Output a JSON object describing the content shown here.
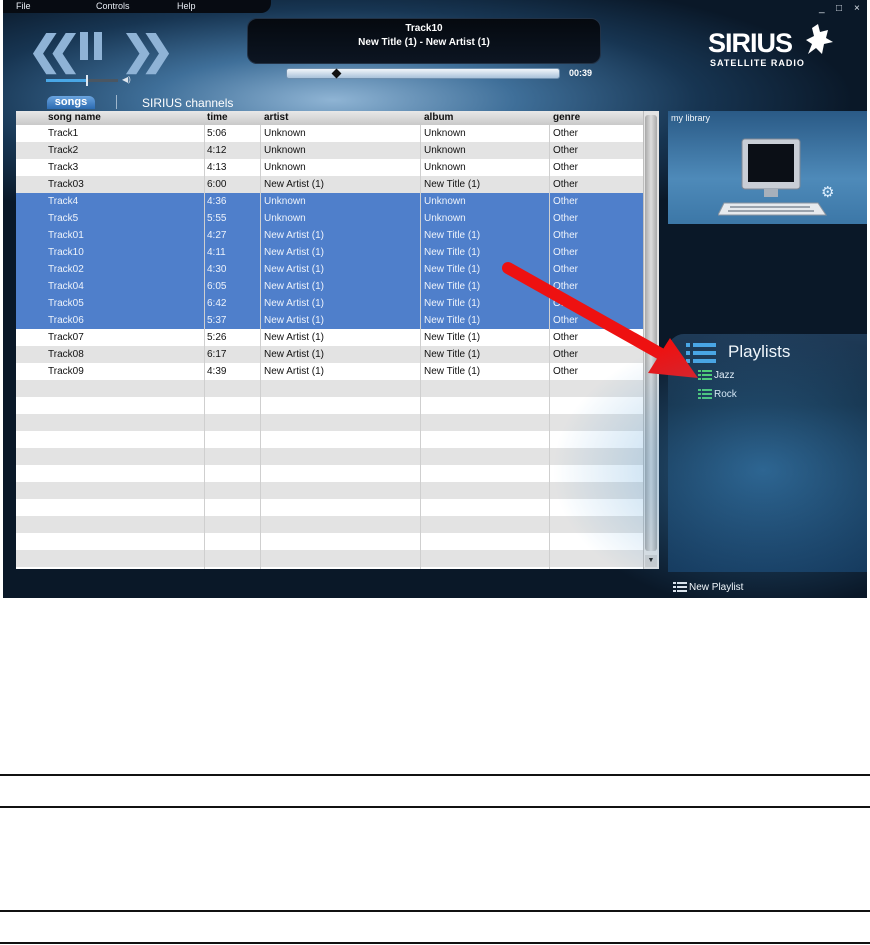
{
  "menu": [
    "File",
    "Controls",
    "Help"
  ],
  "window_controls": [
    "_",
    "□",
    "×"
  ],
  "now_playing": {
    "track": "Track10",
    "subtitle": "New Title (1)  -  New Artist (1)",
    "elapsed": "00:39",
    "progress": 0.18
  },
  "volume": {
    "level": 0.55
  },
  "logo": {
    "word": "SIRIUS",
    "sub": "SATELLITE RADIO"
  },
  "tabs": {
    "songs": "songs",
    "channels": "SIRIUS channels"
  },
  "table": {
    "headers": [
      "song name",
      "time",
      "artist",
      "album",
      "genre"
    ],
    "rows": [
      {
        "name": "Track1",
        "time": "5:06",
        "artist": "Unknown",
        "album": "Unknown",
        "genre": "Other",
        "selected": false
      },
      {
        "name": "Track2",
        "time": "4:12",
        "artist": "Unknown",
        "album": "Unknown",
        "genre": "Other",
        "selected": false
      },
      {
        "name": "Track3",
        "time": "4:13",
        "artist": "Unknown",
        "album": "Unknown",
        "genre": "Other",
        "selected": false
      },
      {
        "name": "Track03",
        "time": "6:00",
        "artist": "New Artist (1)",
        "album": "New Title (1)",
        "genre": "Other",
        "selected": false
      },
      {
        "name": "Track4",
        "time": "4:36",
        "artist": "Unknown",
        "album": "Unknown",
        "genre": "Other",
        "selected": true
      },
      {
        "name": "Track5",
        "time": "5:55",
        "artist": "Unknown",
        "album": "Unknown",
        "genre": "Other",
        "selected": true
      },
      {
        "name": "Track01",
        "time": "4:27",
        "artist": "New Artist (1)",
        "album": "New Title (1)",
        "genre": "Other",
        "selected": true
      },
      {
        "name": "Track10",
        "time": "4:11",
        "artist": "New Artist (1)",
        "album": "New Title (1)",
        "genre": "Other",
        "selected": true
      },
      {
        "name": "Track02",
        "time": "4:30",
        "artist": "New Artist (1)",
        "album": "New Title (1)",
        "genre": "Other",
        "selected": true
      },
      {
        "name": "Track04",
        "time": "6:05",
        "artist": "New Artist (1)",
        "album": "New Title (1)",
        "genre": "Other",
        "selected": true
      },
      {
        "name": "Track05",
        "time": "6:42",
        "artist": "New Artist (1)",
        "album": "New Title (1)",
        "genre": "Other",
        "selected": true
      },
      {
        "name": "Track06",
        "time": "5:37",
        "artist": "New Artist (1)",
        "album": "New Title (1)",
        "genre": "Other",
        "selected": true
      },
      {
        "name": "Track07",
        "time": "5:26",
        "artist": "New Artist (1)",
        "album": "New Title (1)",
        "genre": "Other",
        "selected": false
      },
      {
        "name": "Track08",
        "time": "6:17",
        "artist": "New Artist (1)",
        "album": "New Title (1)",
        "genre": "Other",
        "selected": false
      },
      {
        "name": "Track09",
        "time": "4:39",
        "artist": "New Artist (1)",
        "album": "New Title (1)",
        "genre": "Other",
        "selected": false
      }
    ],
    "empty_rows": 11
  },
  "library": {
    "label": "my library"
  },
  "playlists": {
    "title": "Playlists",
    "items": [
      "Jazz",
      "Rock"
    ],
    "new_label": "New Playlist"
  },
  "colors": {
    "selection": "#4f7fcb",
    "accent_blue": "#49a7e6",
    "arrow_red": "#ee1111"
  }
}
